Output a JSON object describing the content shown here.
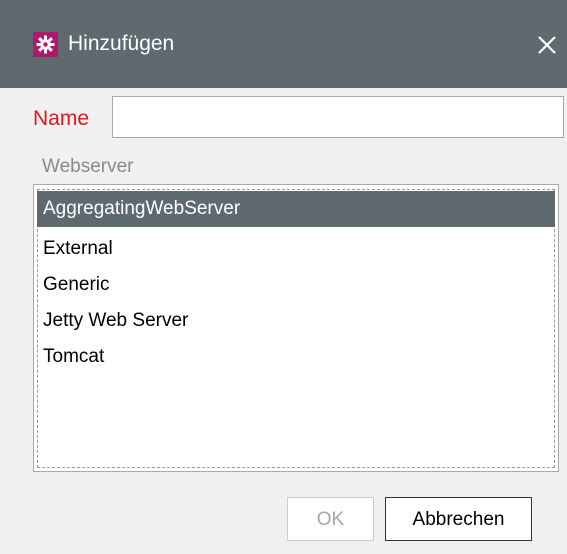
{
  "dialog": {
    "title": "Hinzufügen",
    "app_icon": "gear-icon",
    "close_icon": "close-icon",
    "title_bar_color": "#5f6970",
    "app_icon_color": "#b0196b"
  },
  "form": {
    "name_label": "Name",
    "name_label_color": "#e8141b",
    "name_value": "",
    "webserver_label": "Webserver"
  },
  "webserver_list": {
    "selected_index": 0,
    "items": [
      {
        "label": "AggregatingWebServer",
        "selected": true
      },
      {
        "label": "External",
        "selected": false
      },
      {
        "label": "Generic",
        "selected": false
      },
      {
        "label": "Jetty Web Server",
        "selected": false
      },
      {
        "label": "Tomcat",
        "selected": false
      }
    ]
  },
  "buttons": {
    "ok_label": "OK",
    "ok_enabled": false,
    "cancel_label": "Abbrechen"
  }
}
